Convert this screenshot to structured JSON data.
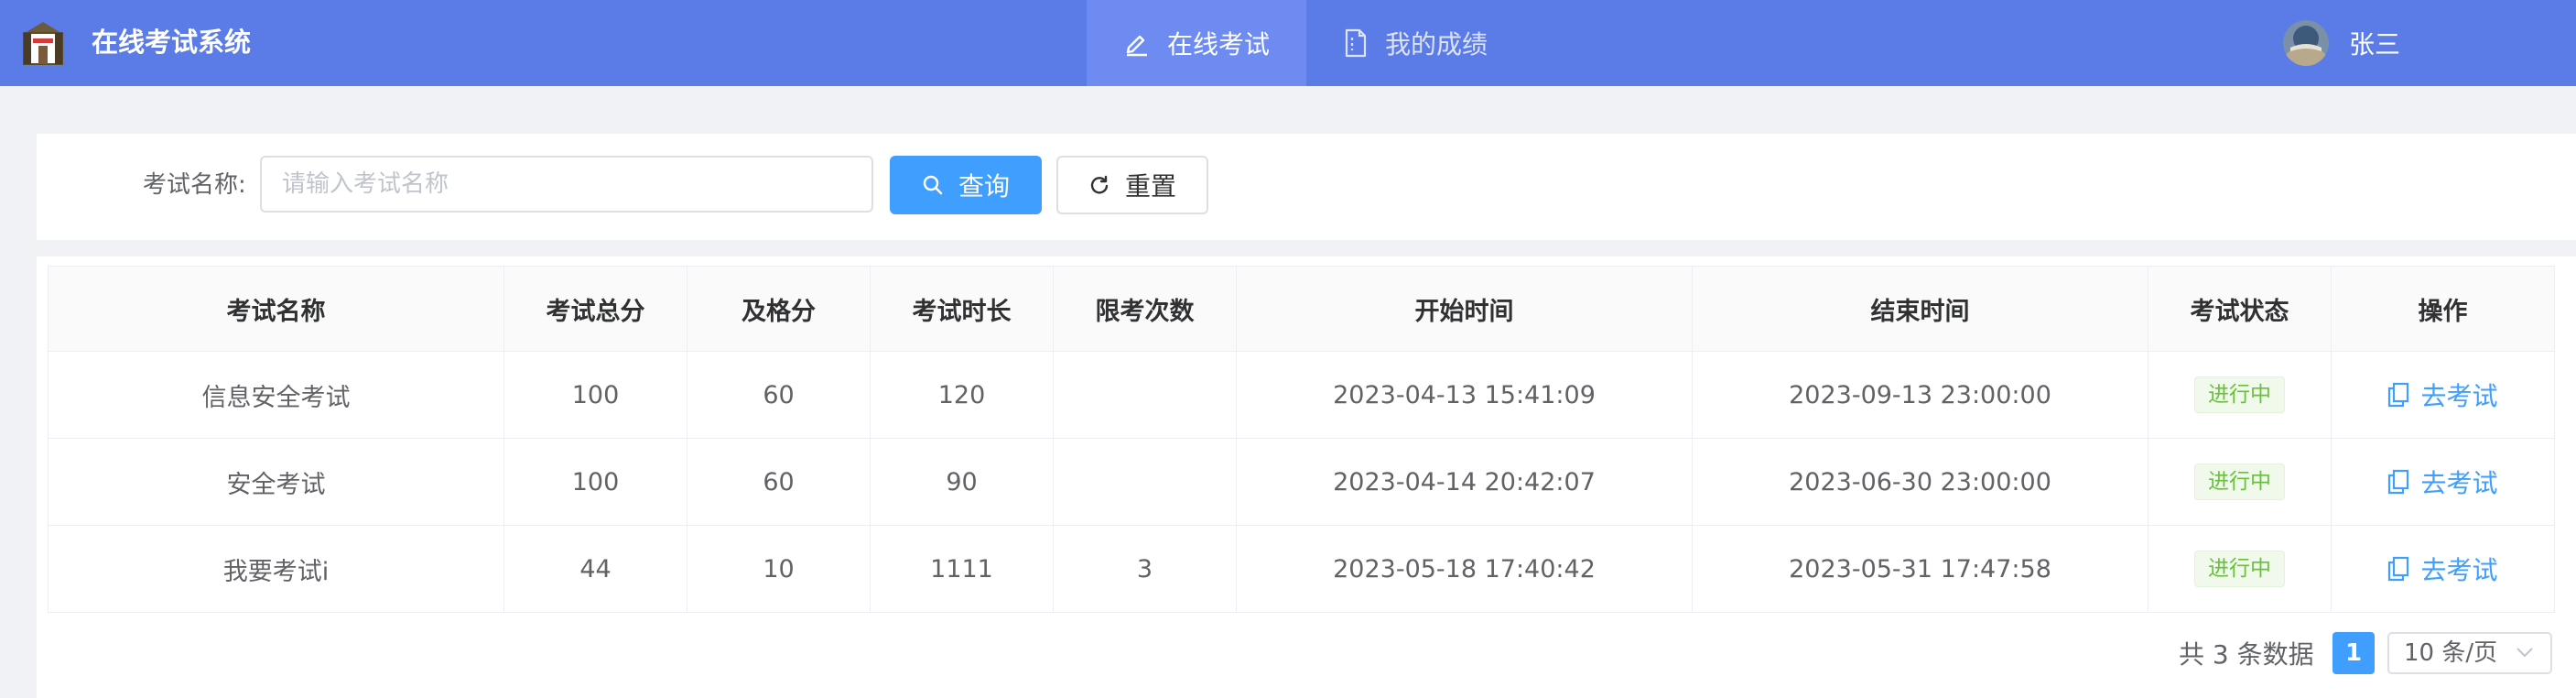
{
  "header": {
    "title": "在线考试系统",
    "nav": [
      {
        "label": "在线考试",
        "icon": "edit-icon",
        "active": true
      },
      {
        "label": "我的成绩",
        "icon": "document-icon",
        "active": false
      }
    ],
    "user_name": "张三"
  },
  "search": {
    "label": "考试名称:",
    "placeholder": "请输入考试名称",
    "value": "",
    "query_label": "查询",
    "reset_label": "重置"
  },
  "table": {
    "columns": [
      "考试名称",
      "考试总分",
      "及格分",
      "考试时长",
      "限考次数",
      "开始时间",
      "结束时间",
      "考试状态",
      "操作"
    ],
    "rows": [
      {
        "name": "信息安全考试",
        "total": "100",
        "pass": "60",
        "duration": "120",
        "limit": "",
        "start": "2023-04-13 15:41:09",
        "end": "2023-09-13 23:00:00",
        "status": "进行中",
        "action": "去考试"
      },
      {
        "name": "安全考试",
        "total": "100",
        "pass": "60",
        "duration": "90",
        "limit": "",
        "start": "2023-04-14 20:42:07",
        "end": "2023-06-30 23:00:00",
        "status": "进行中",
        "action": "去考试"
      },
      {
        "name": "我要考试i",
        "total": "44",
        "pass": "10",
        "duration": "1111",
        "limit": "3",
        "start": "2023-05-18 17:40:42",
        "end": "2023-05-31 17:47:58",
        "status": "进行中",
        "action": "去考试"
      }
    ]
  },
  "pagination": {
    "total_text": "共 3 条数据",
    "current_page": "1",
    "page_size": "10 条/页"
  },
  "colors": {
    "header_bg": "#5b7be6",
    "header_active": "#6d8bf0",
    "primary": "#409eff",
    "success": "#67c23a"
  }
}
